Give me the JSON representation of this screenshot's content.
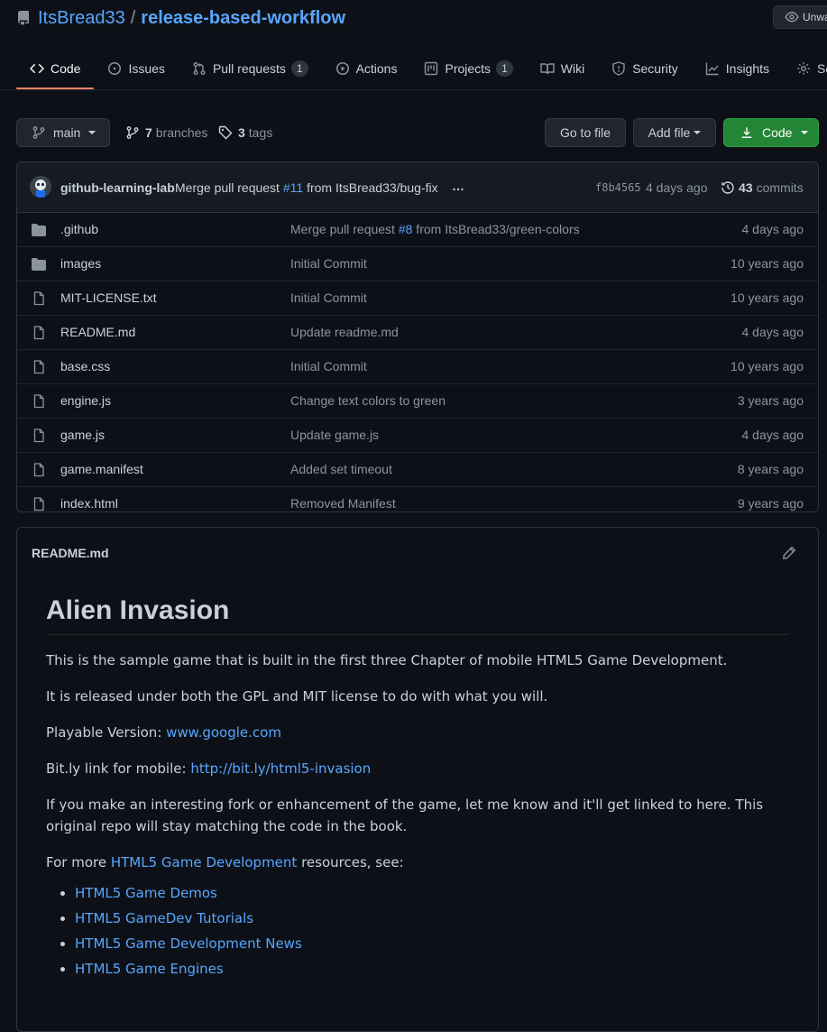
{
  "repo": {
    "owner": "ItsBread33",
    "separator": "/",
    "name": "release-based-workflow",
    "watch_label": "Unwatch"
  },
  "tabs": [
    {
      "label": "Code",
      "icon": "code-icon"
    },
    {
      "label": "Issues",
      "icon": "issue-icon"
    },
    {
      "label": "Pull requests",
      "icon": "pull-request-icon",
      "count": "1"
    },
    {
      "label": "Actions",
      "icon": "play-icon"
    },
    {
      "label": "Projects",
      "icon": "project-icon",
      "count": "1"
    },
    {
      "label": "Wiki",
      "icon": "book-icon"
    },
    {
      "label": "Security",
      "icon": "shield-icon"
    },
    {
      "label": "Insights",
      "icon": "graph-icon"
    },
    {
      "label": "Settings",
      "icon": "gear-icon"
    }
  ],
  "toolbar": {
    "branch": "main",
    "branches_count": "7",
    "branches_label": "branches",
    "tags_count": "3",
    "tags_label": "tags",
    "go_to_file": "Go to file",
    "add_file": "Add file",
    "code": "Code"
  },
  "latest_commit": {
    "author": "github-learning-lab",
    "message_prefix": "Merge pull request",
    "pr": "#11",
    "message_suffix": "from ItsBread33/bug-fix",
    "ellipsis": "…",
    "sha": "f8b4565",
    "date": "4 days ago",
    "commits_count": "43",
    "commits_label": "commits"
  },
  "files": [
    {
      "type": "dir",
      "name": ".github",
      "message": "Merge pull request ",
      "pr": "#8",
      "message_suffix": " from ItsBread33/green-colors",
      "age": "4 days ago"
    },
    {
      "type": "dir",
      "name": "images",
      "message": "Initial Commit",
      "pr": "",
      "message_suffix": "",
      "age": "10 years ago"
    },
    {
      "type": "file",
      "name": "MIT-LICENSE.txt",
      "message": "Initial Commit",
      "pr": "",
      "message_suffix": "",
      "age": "10 years ago"
    },
    {
      "type": "file",
      "name": "README.md",
      "message": "Update readme.md",
      "pr": "",
      "message_suffix": "",
      "age": "4 days ago"
    },
    {
      "type": "file",
      "name": "base.css",
      "message": "Initial Commit",
      "pr": "",
      "message_suffix": "",
      "age": "10 years ago"
    },
    {
      "type": "file",
      "name": "engine.js",
      "message": "Change text colors to green",
      "pr": "",
      "message_suffix": "",
      "age": "3 years ago"
    },
    {
      "type": "file",
      "name": "game.js",
      "message": "Update game.js",
      "pr": "",
      "message_suffix": "",
      "age": "4 days ago"
    },
    {
      "type": "file",
      "name": "game.manifest",
      "message": "Added set timeout",
      "pr": "",
      "message_suffix": "",
      "age": "8 years ago"
    },
    {
      "type": "file",
      "name": "index.html",
      "message": "Removed Manifest",
      "pr": "",
      "message_suffix": "",
      "age": "9 years ago"
    }
  ],
  "readme": {
    "filename": "README.md",
    "title": "Alien Invasion",
    "p1": "This is the sample game that is built in the first three Chapter of mobile HTML5 Game Development.",
    "p2": "It is released under both the GPL and MIT license to do with what you will.",
    "playable_label": "Playable Version: ",
    "playable_link": "www.google.com",
    "bitly_label": "Bit.ly link for mobile: ",
    "bitly_link": "http://bit.ly/html5-invasion",
    "p5": "If you make an interesting fork or enhancement of the game, let me know and it'll get linked to here. This original repo will stay matching the code in the book.",
    "more_prefix": "For more ",
    "more_link": "HTML5 Game Development",
    "more_suffix": " resources, see:",
    "resources": [
      "HTML5 Game Demos",
      "HTML5 GameDev Tutorials",
      "HTML5 Game Development News",
      "HTML5 Game Engines"
    ]
  },
  "colors": {
    "background": "#0d1117",
    "link": "#58a6ff",
    "green_button": "#238636",
    "active_tab_underline": "#f78166"
  }
}
